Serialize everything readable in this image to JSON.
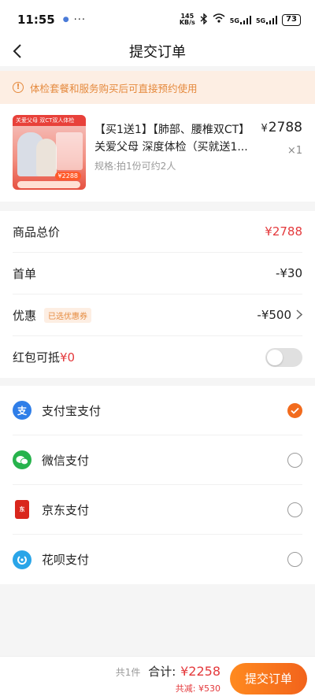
{
  "status_bar": {
    "time": "11:55",
    "speed_value": "145",
    "speed_unit": "KB/s",
    "signal1": "5G",
    "signal2": "5G",
    "battery": "73"
  },
  "nav": {
    "title": "提交订单"
  },
  "notice": {
    "text": "体检套餐和服务购买后可直接预约使用"
  },
  "product": {
    "name": "【买1送1】【肺部、腰椎双CT】关爱父母 深度体检（买就送1...",
    "spec": "规格:拍1份可约2人",
    "currency": "¥",
    "price": "2788",
    "quantity": "×1",
    "thumb_banner": "关爱父母 双CT双人体检",
    "thumb_price": "¥2288"
  },
  "summary": {
    "total_label": "商品总价",
    "total_value": "¥2788",
    "first_order_label": "首单",
    "first_order_value": "-¥30",
    "discount_label": "优惠",
    "discount_tag": "已选优惠券",
    "discount_value": "-¥500",
    "red_packet_label": "红包可抵",
    "red_packet_value": "¥0"
  },
  "payments": [
    {
      "label": "支付宝支付",
      "icon": "alipay-icon",
      "selected": true
    },
    {
      "label": "微信支付",
      "icon": "wechat-pay-icon",
      "selected": false
    },
    {
      "label": "京东支付",
      "icon": "jd-pay-icon",
      "selected": false
    },
    {
      "label": "花呗支付",
      "icon": "huabei-icon",
      "selected": false
    }
  ],
  "footer": {
    "count": "共1件",
    "total_label": "合计:",
    "total_value": "¥2258",
    "saved": "共减: ¥530",
    "submit_label": "提交订单"
  },
  "colors": {
    "accent": "#f26b1d",
    "price_red": "#e4393c",
    "notice_bg": "#fdeee3"
  }
}
